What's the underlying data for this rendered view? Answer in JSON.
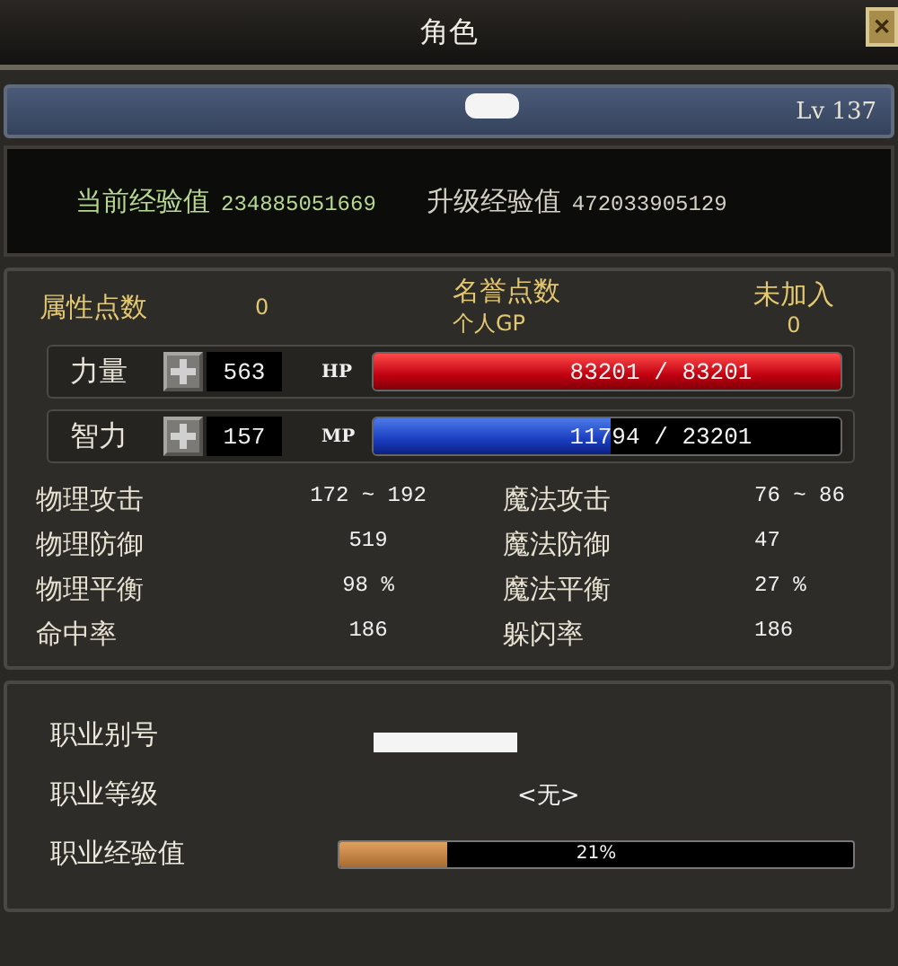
{
  "window": {
    "title": "角色",
    "close": "✕"
  },
  "level_bar": {
    "level_text": "Lv 137"
  },
  "experience": [
    {
      "label": "当前经验值",
      "value": "234885051669",
      "kind": "current"
    },
    {
      "label": "升级经验值",
      "value": "472033905129",
      "kind": "next"
    }
  ],
  "points": {
    "attribute_label": "属性点数",
    "attribute_value": "0",
    "honor_label": "名誉点数",
    "honor_value": "未加入",
    "gp_label": "个人GP",
    "gp_value": "0"
  },
  "attributes": [
    {
      "label": "力量",
      "value": "563",
      "bar_label": "HP",
      "reading": "83201 / 83201",
      "level": 1.0,
      "kind": "hp"
    },
    {
      "label": "智力",
      "value": "157",
      "bar_label": "MP",
      "reading": "11794 / 23201",
      "level": 0.508,
      "kind": "mp"
    }
  ],
  "stats": [
    {
      "label": "物理攻击",
      "value": "172 ~ 192"
    },
    {
      "label": "魔法攻击",
      "value": "76 ~ 86"
    },
    {
      "label": "物理防御",
      "value": "519"
    },
    {
      "label": "魔法防御",
      "value": "47"
    },
    {
      "label": "物理平衡",
      "value": "98 %"
    },
    {
      "label": "魔法平衡",
      "value": "27 %"
    },
    {
      "label": "命中率",
      "value": "186"
    },
    {
      "label": "躲闪率",
      "value": "186"
    }
  ],
  "job": {
    "alias_label": "职业别号",
    "rank_label": "职业等级",
    "rank_value": "<无>",
    "exp_label": "职业经验值",
    "exp_reading": "21%",
    "level": 0.21
  }
}
